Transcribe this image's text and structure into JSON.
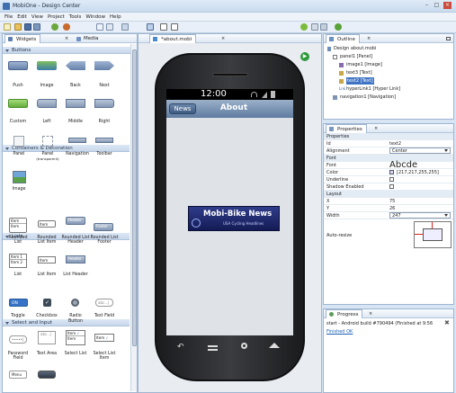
{
  "window": {
    "title": "MobiOne - Design Center"
  },
  "menu": [
    "File",
    "Edit",
    "View",
    "Project",
    "Tools",
    "Window",
    "Help"
  ],
  "palette": {
    "tabs": [
      "Widgets",
      "Media"
    ],
    "sections": {
      "buttons": {
        "title": "Buttons",
        "items": [
          "Push",
          "Image",
          "Back",
          "Next",
          "Custom",
          "Left",
          "Middle",
          "Right"
        ]
      },
      "containers": {
        "title": "Containers & Decoration",
        "items": [
          "Panel",
          "Panel",
          "Navigation",
          "Toolbar",
          "Image"
        ],
        "panel_sub": "(transparent)"
      },
      "lists": {
        "title": "Lists",
        "items": [
          "Rounded List",
          "Rounded List Item",
          "Rounded List Header",
          "Rounded List Footer",
          "List",
          "List Item",
          "List Header"
        ],
        "rl_items": [
          "Item",
          "Item"
        ],
        "li_item": "Item",
        "header_label": "Header",
        "footer_label": "Footer",
        "list_items": [
          "Item 1",
          "Item 2"
        ]
      },
      "select": {
        "title": "Select and Input",
        "items": [
          "Toggle",
          "Checkbox",
          "Radio Button",
          "Text Field",
          "Password Field",
          "Text Area",
          "Select List",
          "Select List Item"
        ],
        "toggle_on": "ON",
        "textfield_ph": "abc...|",
        "password_ph": "•••••|",
        "textarea_ph": "abc...|",
        "select_items": [
          "Item",
          "Item"
        ],
        "menu_label": "Menu"
      }
    }
  },
  "editor": {
    "tab": "*about.mobi",
    "phone": {
      "time": "12:00",
      "nav_button": "News",
      "nav_title": "About",
      "logo_title": "Mobi-Bike News",
      "logo_subtitle": "USA Cycling Headlines"
    }
  },
  "outline": {
    "title": "Outline",
    "items": [
      "Design about.mobi",
      "panel1 [Panel]",
      "image1 [Image]",
      "text3 [Text]",
      "text2 [Text]",
      "hyperLink1 [Hyper Link]",
      "navigation1 [Navigation]"
    ]
  },
  "properties": {
    "title": "Properties",
    "sections": {
      "properties": "Properties",
      "font": "Font",
      "layout": "Layout"
    },
    "rows": {
      "id": {
        "k": "Id",
        "v": "text2"
      },
      "alignment": {
        "k": "Alignment",
        "v": "Center"
      },
      "font": {
        "k": "Font",
        "v": "Abcde"
      },
      "color": {
        "k": "Color",
        "v": "[217,217,255,255]"
      },
      "underline": {
        "k": "Underline",
        "v": ""
      },
      "shadow": {
        "k": "Shadow Enabled",
        "v": ""
      },
      "x": {
        "k": "X",
        "v": "75"
      },
      "y": {
        "k": "Y",
        "v": "26"
      },
      "width": {
        "k": "Width",
        "v": "247"
      },
      "autoresize": {
        "k": "Auto-resize",
        "v": ""
      }
    }
  },
  "progress": {
    "title": "Progress",
    "task": "start - Android build #790494 (Finished at 9:56",
    "status": "Finished OK"
  },
  "colors": {
    "accent": "#1a5fb4",
    "phone_bg": "#dfe3e8",
    "navbar": "#5f7c9e"
  }
}
